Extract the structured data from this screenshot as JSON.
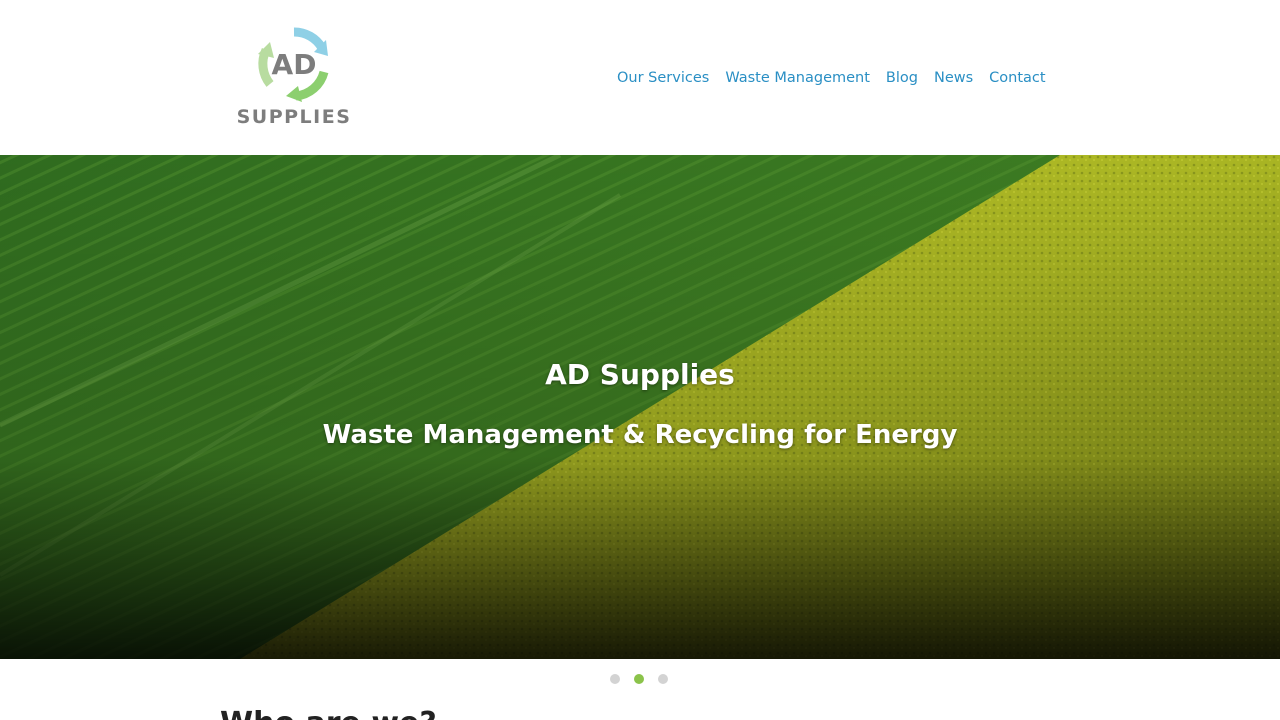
{
  "brand": {
    "logo_letters": "AD",
    "logo_word": "SUPPLIES"
  },
  "nav": {
    "items": [
      {
        "label": "Our Services"
      },
      {
        "label": "Waste Management"
      },
      {
        "label": "Blog"
      },
      {
        "label": "News"
      },
      {
        "label": "Contact"
      }
    ]
  },
  "hero": {
    "title": "AD Supplies",
    "subtitle": "Waste Management & Recycling for Energy"
  },
  "slider": {
    "total": 3,
    "active_index": 1
  },
  "section": {
    "heading": "Who are we?"
  },
  "colors": {
    "nav_link": "#2a8fc4",
    "logo_grey": "#7d7d7d",
    "active_dot": "#8bc34a",
    "inactive_dot": "#d3d3d3"
  }
}
